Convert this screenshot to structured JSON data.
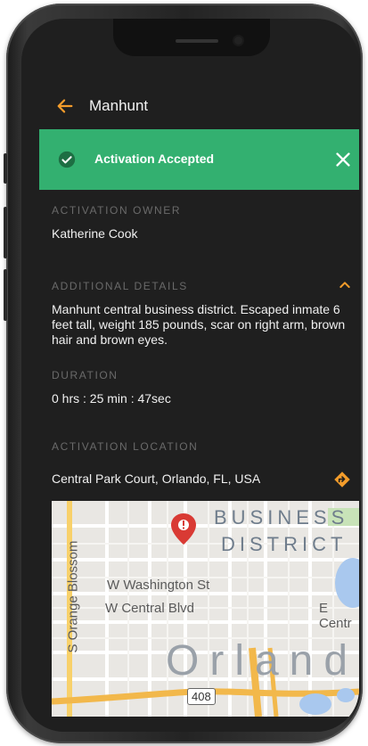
{
  "app_bar": {
    "title": "Manhunt",
    "back_icon": "arrow-left-icon"
  },
  "banner": {
    "text": "Activation Accepted",
    "status_icon": "check-circle-icon",
    "close_icon": "close-icon",
    "color": "#33b070"
  },
  "owner": {
    "label": "ACTIVATION OWNER",
    "value": "Katherine Cook"
  },
  "details": {
    "label": "ADDITIONAL DETAILS",
    "toggle_icon": "chevron-up-icon",
    "text": "Manhunt central business district. Escaped inmate 6 feet tall, weight 185 pounds, scar on right arm, brown hair and brown eyes."
  },
  "duration": {
    "label": "DURATION",
    "value": "0 hrs : 25 min : 47sec"
  },
  "location": {
    "label": "ACTIVATION LOCATION",
    "address": "Central Park Court, Orlando, FL, USA",
    "directions_icon": "directions-icon"
  },
  "map": {
    "labels": {
      "business": "BUSINESS",
      "district": "DISTRICT",
      "washington": "W Washington St",
      "central": "W Central Blvd",
      "central_east": "E Centr",
      "city": "Orland",
      "blossom": "S Orange Blossom",
      "shield": "408"
    },
    "pin_icon": "map-pin-icon"
  },
  "colors": {
    "accent": "#f39c2b",
    "background": "#1f1f1f",
    "label": "#6a6a6a"
  }
}
